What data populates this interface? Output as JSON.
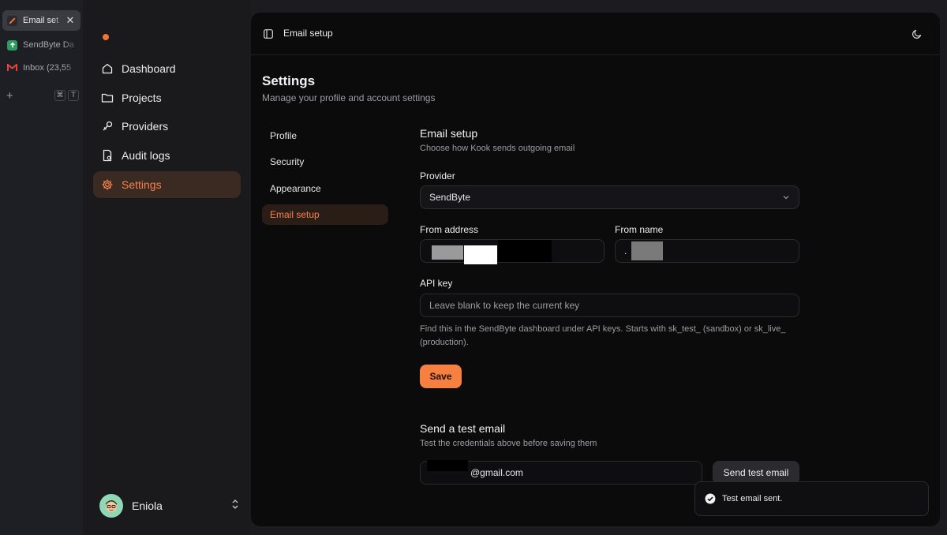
{
  "browser": {
    "tabs": [
      {
        "title": "Email set",
        "favicon": "kook-icon",
        "color": "#f0743a",
        "active": true
      },
      {
        "title": "SendByte Da",
        "favicon": "sendbyte-icon",
        "color": "#2f9b63",
        "active": false
      },
      {
        "title": "Inbox (23,55",
        "favicon": "gmail-icon",
        "color": "#ea4335",
        "active": false
      }
    ],
    "new_tab_shortcut": [
      "⌘",
      "T"
    ]
  },
  "sidebar": {
    "items": [
      {
        "label": "Dashboard",
        "icon": "home-icon"
      },
      {
        "label": "Projects",
        "icon": "folder-icon"
      },
      {
        "label": "Providers",
        "icon": "plug-icon"
      },
      {
        "label": "Audit logs",
        "icon": "file-icon"
      },
      {
        "label": "Settings",
        "icon": "gear-icon",
        "active": true
      }
    ],
    "user": {
      "name": "Eniola"
    }
  },
  "header": {
    "title": "Email setup"
  },
  "settings": {
    "title": "Settings",
    "subtitle": "Manage your profile and account settings",
    "nav": [
      {
        "label": "Profile"
      },
      {
        "label": "Security"
      },
      {
        "label": "Appearance"
      },
      {
        "label": "Email setup",
        "active": true
      }
    ]
  },
  "email_setup": {
    "title": "Email setup",
    "subtitle": "Choose how Kook sends outgoing email",
    "provider_label": "Provider",
    "provider_value": "SendByte",
    "from_address_label": "From address",
    "from_name_label": "From name",
    "from_name_value": ".",
    "api_key_label": "API key",
    "api_key_placeholder": "Leave blank to keep the current key",
    "help_text": "Find this in the SendByte dashboard under API keys. Starts with sk_test_ (sandbox) or sk_live_ (production).",
    "save_label": "Save"
  },
  "test_email": {
    "title": "Send a test email",
    "subtitle": "Test the credentials above before saving them",
    "email_value": "@gmail.com",
    "send_label": "Send test email"
  },
  "toast": {
    "message": "Test email sent."
  },
  "colors": {
    "accent": "#f5803f",
    "active_bg": "#3a2a22"
  }
}
